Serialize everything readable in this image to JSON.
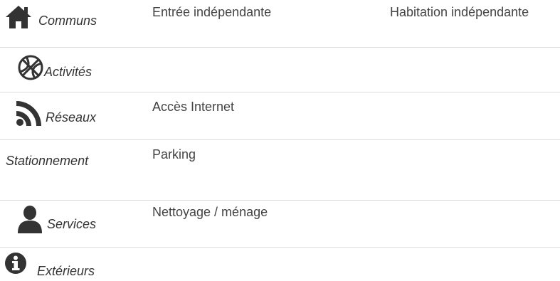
{
  "amenities": {
    "rows": [
      {
        "category": "Communs",
        "icon": "home-icon",
        "items": [
          "Entrée indépendante",
          "Habitation indépendante"
        ]
      },
      {
        "category": "Activités",
        "icon": "basketball-icon",
        "items": []
      },
      {
        "category": "Réseaux",
        "icon": "rss-icon",
        "items": [
          "Accès Internet"
        ]
      },
      {
        "category": "Stationnement",
        "icon": null,
        "items": [
          "Parking"
        ]
      },
      {
        "category": "Services",
        "icon": "user-icon",
        "items": [
          "Nettoyage / ménage"
        ]
      },
      {
        "category": "Extérieurs",
        "icon": "info-circle-icon",
        "items": []
      }
    ]
  }
}
